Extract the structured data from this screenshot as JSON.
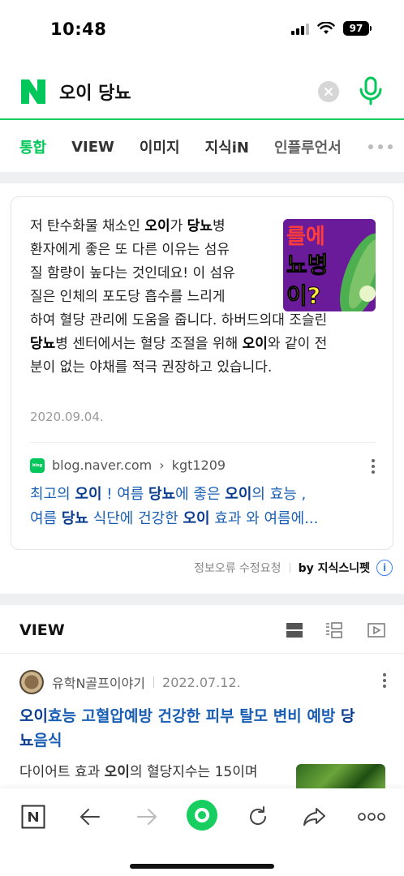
{
  "status": {
    "time": "10:48",
    "battery": "97"
  },
  "search": {
    "query": "오이 당뇨"
  },
  "tabs": [
    {
      "label": "통합"
    },
    {
      "label": "VIEW"
    },
    {
      "label": "이미지"
    },
    {
      "label": "지식iN"
    },
    {
      "label": "인플루언서"
    }
  ],
  "snippet": {
    "line1": [
      "저 탄수화물 채소인 ",
      "오이",
      "가 ",
      "당뇨",
      "병"
    ],
    "line2": "환자에게 좋은 또 다른 이유는 섬유",
    "line3": "질 함량이 높다는 것인데요! 이 섬유",
    "line4": "질은 인체의 포도당 흡수를 느리게",
    "full1": "하여 혈당 관리에 도움을 줍니다. 하버드의대 조슬린",
    "full2": [
      "당뇨",
      "병 센터에서는 혈당 조절을 위해 ",
      "오이",
      "와 같이 전"
    ],
    "full3": "분이 없는 야채를 적극 권장하고 있습니다.",
    "date": "2020.09.04.",
    "thumb_text": [
      "를에",
      "뇨병",
      "이?"
    ],
    "source_icon": "blog",
    "source_domain": "blog.naver.com",
    "source_path": "kgt1209",
    "link_title": [
      "최고의 ",
      "오이",
      " ! 여름 ",
      "당뇨",
      "에 좋은 ",
      "오이",
      "의 효능 ,"
    ],
    "link_title2": [
      "여름 ",
      "당뇨",
      " 식단에 건강한 ",
      "오이",
      " 효과 와 여름에..."
    ]
  },
  "report": {
    "error_label": "정보오류 수정요청",
    "by": "by",
    "source_name": "지식스니펫"
  },
  "view": {
    "title": "VIEW",
    "post": {
      "author": "유학N골프이야기",
      "date": "2022.07.12.",
      "title_parts": [
        "오이",
        "효능 고혈압예방 건강한 피부 탈모 변비 예방 ",
        "당"
      ],
      "title_line2": [
        "뇨",
        "음식"
      ],
      "excerpt": [
        "다이어트 효과 ",
        "오이",
        "의 혈당지수는 15이며"
      ]
    }
  },
  "colors": {
    "accent": "#03c75a",
    "link": "#1a5fb4"
  }
}
